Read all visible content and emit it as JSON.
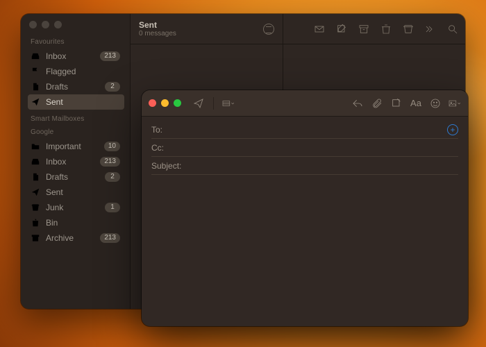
{
  "sidebar": {
    "sections": {
      "favourites": {
        "heading": "Favourites",
        "items": [
          {
            "icon": "inbox",
            "label": "Inbox",
            "badge": "213"
          },
          {
            "icon": "flag",
            "label": "Flagged",
            "badge": ""
          },
          {
            "icon": "doc",
            "label": "Drafts",
            "badge": "2"
          },
          {
            "icon": "send",
            "label": "Sent",
            "badge": "",
            "selected": true
          }
        ]
      },
      "smart": {
        "heading": "Smart Mailboxes"
      },
      "google": {
        "heading": "Google",
        "items": [
          {
            "icon": "folder",
            "label": "Important",
            "badge": "10"
          },
          {
            "icon": "inbox",
            "label": "Inbox",
            "badge": "213"
          },
          {
            "icon": "doc",
            "label": "Drafts",
            "badge": "2"
          },
          {
            "icon": "send",
            "label": "Sent",
            "badge": ""
          },
          {
            "icon": "junk",
            "label": "Junk",
            "badge": "1"
          },
          {
            "icon": "trash",
            "label": "Bin",
            "badge": ""
          },
          {
            "icon": "archive",
            "label": "Archive",
            "badge": "213"
          }
        ]
      }
    }
  },
  "messagelist": {
    "title": "Sent",
    "subtitle": "0 messages"
  },
  "compose": {
    "fields": {
      "to": {
        "label": "To:",
        "value": ""
      },
      "cc": {
        "label": "Cc:",
        "value": ""
      },
      "subject": {
        "label": "Subject:",
        "value": ""
      }
    },
    "format_label": "Aa"
  }
}
